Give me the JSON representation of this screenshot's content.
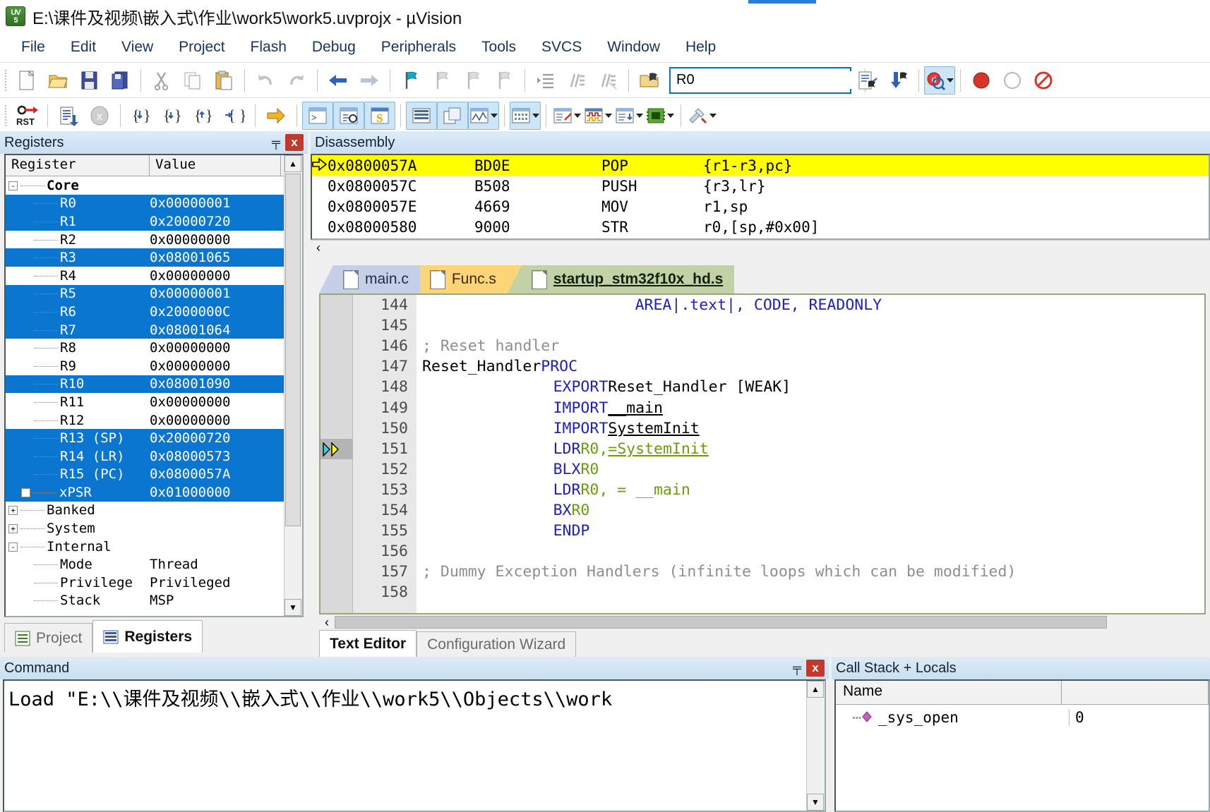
{
  "window": {
    "title": "E:\\课件及视频\\嵌入式\\作业\\work5\\work5.uvprojx - µVision",
    "app_icon": "uvision-icon"
  },
  "menubar": {
    "items": [
      "File",
      "Edit",
      "View",
      "Project",
      "Flash",
      "Debug",
      "Peripherals",
      "Tools",
      "SVCS",
      "Window",
      "Help"
    ]
  },
  "toolbar": {
    "search_value": "R0",
    "search_placeholder": ""
  },
  "registers_pane": {
    "title": "Registers",
    "pin_glyph": "╤",
    "close_glyph": "x",
    "columns": [
      "Register",
      "Value"
    ],
    "rows": [
      {
        "name": "Core",
        "value": "",
        "level": 0,
        "tw": "-",
        "sel": false,
        "bold": true
      },
      {
        "name": "R0",
        "value": "0x00000001",
        "level": 2,
        "tw": "",
        "sel": true
      },
      {
        "name": "R1",
        "value": "0x20000720",
        "level": 2,
        "tw": "",
        "sel": true
      },
      {
        "name": "R2",
        "value": "0x00000000",
        "level": 2,
        "tw": "",
        "sel": false
      },
      {
        "name": "R3",
        "value": "0x08001065",
        "level": 2,
        "tw": "",
        "sel": true
      },
      {
        "name": "R4",
        "value": "0x00000000",
        "level": 2,
        "tw": "",
        "sel": false
      },
      {
        "name": "R5",
        "value": "0x00000001",
        "level": 2,
        "tw": "",
        "sel": true
      },
      {
        "name": "R6",
        "value": "0x2000000C",
        "level": 2,
        "tw": "",
        "sel": true
      },
      {
        "name": "R7",
        "value": "0x08001064",
        "level": 2,
        "tw": "",
        "sel": true
      },
      {
        "name": "R8",
        "value": "0x00000000",
        "level": 2,
        "tw": "",
        "sel": false
      },
      {
        "name": "R9",
        "value": "0x00000000",
        "level": 2,
        "tw": "",
        "sel": false
      },
      {
        "name": "R10",
        "value": "0x08001090",
        "level": 2,
        "tw": "",
        "sel": true
      },
      {
        "name": "R11",
        "value": "0x00000000",
        "level": 2,
        "tw": "",
        "sel": false
      },
      {
        "name": "R12",
        "value": "0x00000000",
        "level": 2,
        "tw": "",
        "sel": false
      },
      {
        "name": "R13 (SP)",
        "value": "0x20000720",
        "level": 2,
        "tw": "",
        "sel": true
      },
      {
        "name": "R14 (LR)",
        "value": "0x08000573",
        "level": 2,
        "tw": "",
        "sel": true
      },
      {
        "name": "R15 (PC)",
        "value": "0x0800057A",
        "level": 2,
        "tw": "",
        "sel": true
      },
      {
        "name": "xPSR",
        "value": "0x01000000",
        "level": 1,
        "tw": "+",
        "sel": true
      },
      {
        "name": "Banked",
        "value": "",
        "level": 0,
        "tw": "+",
        "sel": false
      },
      {
        "name": "System",
        "value": "",
        "level": 0,
        "tw": "+",
        "sel": false
      },
      {
        "name": "Internal",
        "value": "",
        "level": 0,
        "tw": "-",
        "sel": false
      },
      {
        "name": "Mode",
        "value": "Thread",
        "level": 2,
        "tw": "",
        "sel": false
      },
      {
        "name": "Privilege",
        "value": "Privileged",
        "level": 2,
        "tw": "",
        "sel": false
      },
      {
        "name": "Stack",
        "value": "MSP",
        "level": 2,
        "tw": "",
        "sel": false
      }
    ],
    "bottom_tabs": [
      {
        "label": "Project",
        "icon": "project-icon",
        "active": false
      },
      {
        "label": "Registers",
        "icon": "registers-icon",
        "active": true
      }
    ]
  },
  "disassembly_pane": {
    "title": "Disassembly",
    "lines": [
      {
        "addr": "0x0800057A",
        "code": "BD0E",
        "op": "POP",
        "args": "{r1-r3,pc}",
        "current": true
      },
      {
        "addr": "0x0800057C",
        "code": "B508",
        "op": "PUSH",
        "args": "{r3,lr}",
        "current": false
      },
      {
        "addr": "0x0800057E",
        "code": "4669",
        "op": "MOV",
        "args": "r1,sp",
        "current": false
      },
      {
        "addr": "0x08000580",
        "code": "9000",
        "op": "STR",
        "args": "r0,[sp,#0x00]",
        "current": false
      }
    ],
    "scroll_left_glyph": "‹"
  },
  "editor": {
    "tabs": [
      {
        "label": "main.c",
        "active": false
      },
      {
        "label": "Func.s",
        "active": false
      },
      {
        "label": "startup_stm32f10x_hd.s",
        "active": true
      }
    ],
    "code_lines": [
      {
        "num": "144",
        "indent": 26,
        "tokens": [
          {
            "t": "AREA",
            "c": "kw"
          },
          {
            "t": "     |.text|, CODE, READONLY",
            "c": "kw"
          }
        ],
        "marker": ""
      },
      {
        "num": "145",
        "indent": 0,
        "tokens": [],
        "marker": ""
      },
      {
        "num": "146",
        "indent": 0,
        "tokens": [
          {
            "t": "; Reset handler",
            "c": "cmt"
          }
        ],
        "marker": ""
      },
      {
        "num": "147",
        "indent": 0,
        "tokens": [
          {
            "t": "Reset_Handler   ",
            "c": "lbl"
          },
          {
            "t": "PROC",
            "c": "kw"
          }
        ],
        "marker": ""
      },
      {
        "num": "148",
        "indent": 16,
        "tokens": [
          {
            "t": "EXPORT",
            "c": "kw"
          },
          {
            "t": "  Reset_Handler               [WEAK]",
            "c": "lbl"
          }
        ],
        "marker": ""
      },
      {
        "num": "149",
        "indent": 16,
        "tokens": [
          {
            "t": "IMPORT",
            "c": "kw"
          },
          {
            "t": "  __main",
            "c": "ul"
          }
        ],
        "marker": ""
      },
      {
        "num": "150",
        "indent": 16,
        "tokens": [
          {
            "t": "IMPORT",
            "c": "kw"
          },
          {
            "t": "  SystemInit",
            "c": "ul"
          }
        ],
        "marker": ""
      },
      {
        "num": "151",
        "indent": 16,
        "tokens": [
          {
            "t": "LDR",
            "c": "kw"
          },
          {
            "t": "     R0, ",
            "c": "reg"
          },
          {
            "t": "=SystemInit",
            "c": "reg ul"
          }
        ],
        "marker": "exec"
      },
      {
        "num": "152",
        "indent": 16,
        "tokens": [
          {
            "t": "BLX",
            "c": "kw"
          },
          {
            "t": "     R0",
            "c": "reg"
          }
        ],
        "marker": ""
      },
      {
        "num": "153",
        "indent": 16,
        "tokens": [
          {
            "t": "LDR",
            "c": "kw"
          },
          {
            "t": "     R0, = __main",
            "c": "reg"
          }
        ],
        "marker": ""
      },
      {
        "num": "154",
        "indent": 16,
        "tokens": [
          {
            "t": "BX",
            "c": "kw"
          },
          {
            "t": "      R0",
            "c": "reg"
          }
        ],
        "marker": ""
      },
      {
        "num": "155",
        "indent": 16,
        "tokens": [
          {
            "t": "ENDP",
            "c": "kw"
          }
        ],
        "marker": ""
      },
      {
        "num": "156",
        "indent": 0,
        "tokens": [],
        "marker": ""
      },
      {
        "num": "157",
        "indent": 0,
        "tokens": [
          {
            "t": "; Dummy Exception Handlers (infinite loops which can be modified)",
            "c": "cmt"
          }
        ],
        "marker": ""
      },
      {
        "num": "158",
        "indent": 0,
        "tokens": [],
        "marker": ""
      }
    ],
    "bottom_tabs": [
      {
        "label": "Text Editor",
        "active": true
      },
      {
        "label": "Configuration Wizard",
        "active": false
      }
    ],
    "scroll_left_glyph": "‹"
  },
  "command_pane": {
    "title": "Command",
    "pin_glyph": "╤",
    "close_glyph": "x",
    "text": "Load \"E:\\\\课件及视频\\\\嵌入式\\\\作业\\\\work5\\\\Objects\\\\work"
  },
  "callstack_pane": {
    "title": "Call Stack + Locals",
    "columns": [
      "Name",
      ""
    ],
    "rows": [
      {
        "name": "_sys_open",
        "value": "0",
        "icon": "function-icon"
      }
    ]
  },
  "colors": {
    "selection_blue": "#0b76d0",
    "current_line_yellow": "#ffff00",
    "caption_blue": "#cde6f7",
    "tab_active_green": "#c2d2a6"
  }
}
